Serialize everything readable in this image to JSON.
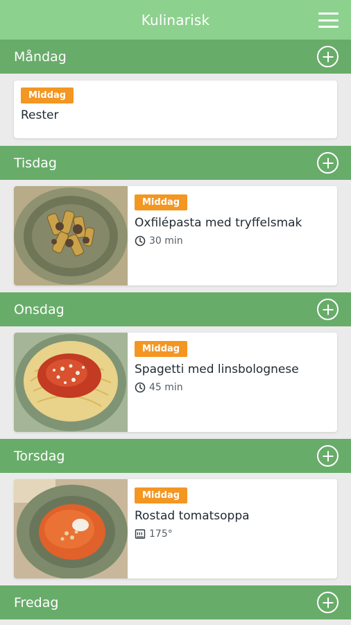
{
  "app": {
    "title": "Kulinarisk"
  },
  "days": [
    {
      "label": "Måndag",
      "meals": [
        {
          "badge": "Middag",
          "name": "Rester"
        }
      ]
    },
    {
      "label": "Tisdag",
      "meals": [
        {
          "badge": "Middag",
          "name": "Oxfilépasta med tryffelsmak",
          "meta_icon": "clock-icon",
          "meta": "30 min"
        }
      ]
    },
    {
      "label": "Onsdag",
      "meals": [
        {
          "badge": "Middag",
          "name": "Spagetti med linsbolognese",
          "meta_icon": "clock-icon",
          "meta": "45 min"
        }
      ]
    },
    {
      "label": "Torsdag",
      "meals": [
        {
          "badge": "Middag",
          "name": "Rostad tomatsoppa",
          "meta_icon": "oven-icon",
          "meta": "175°"
        }
      ]
    },
    {
      "label": "Fredag",
      "meals": []
    }
  ],
  "colors": {
    "topbar": "#8dd18e",
    "day_header": "#68ac6a",
    "badge": "#f39622",
    "background": "#ebebeb"
  }
}
